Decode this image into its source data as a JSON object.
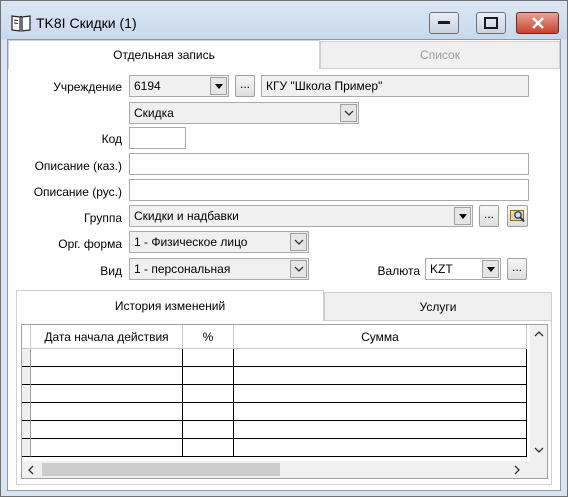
{
  "window": {
    "title": "TK8I Скидки (1)"
  },
  "tabs": [
    {
      "label": "Отдельная запись",
      "active": true
    },
    {
      "label": "Список",
      "active": false
    }
  ],
  "form": {
    "institution_label": "Учреждение",
    "institution_code": "6194",
    "institution_name": "КГУ \"Школа Пример\"",
    "type_value": "Скидка",
    "code_label": "Код",
    "code_value": "",
    "desc_kaz_label": "Описание (каз.)",
    "desc_kaz_value": "",
    "desc_rus_label": "Описание (рус.)",
    "desc_rus_value": "",
    "group_label": "Группа",
    "group_value": "Скидки и надбавки",
    "org_form_label": "Орг. форма",
    "org_form_value": "1 - Физическое лицо",
    "kind_label": "Вид",
    "kind_value": "1 - персональная",
    "currency_label": "Валюта",
    "currency_value": "KZT",
    "ellipsis": "..."
  },
  "lower_tabs": [
    {
      "label": "История изменений",
      "active": true
    },
    {
      "label": "Услуги",
      "active": false
    }
  ],
  "grid": {
    "columns": [
      "Дата начала действия",
      "%",
      "Сумма"
    ],
    "rows": [
      [
        "",
        "",
        ""
      ],
      [
        "",
        "",
        ""
      ],
      [
        "",
        "",
        ""
      ],
      [
        "",
        "",
        ""
      ],
      [
        "",
        "",
        ""
      ],
      [
        "",
        "",
        ""
      ]
    ]
  }
}
